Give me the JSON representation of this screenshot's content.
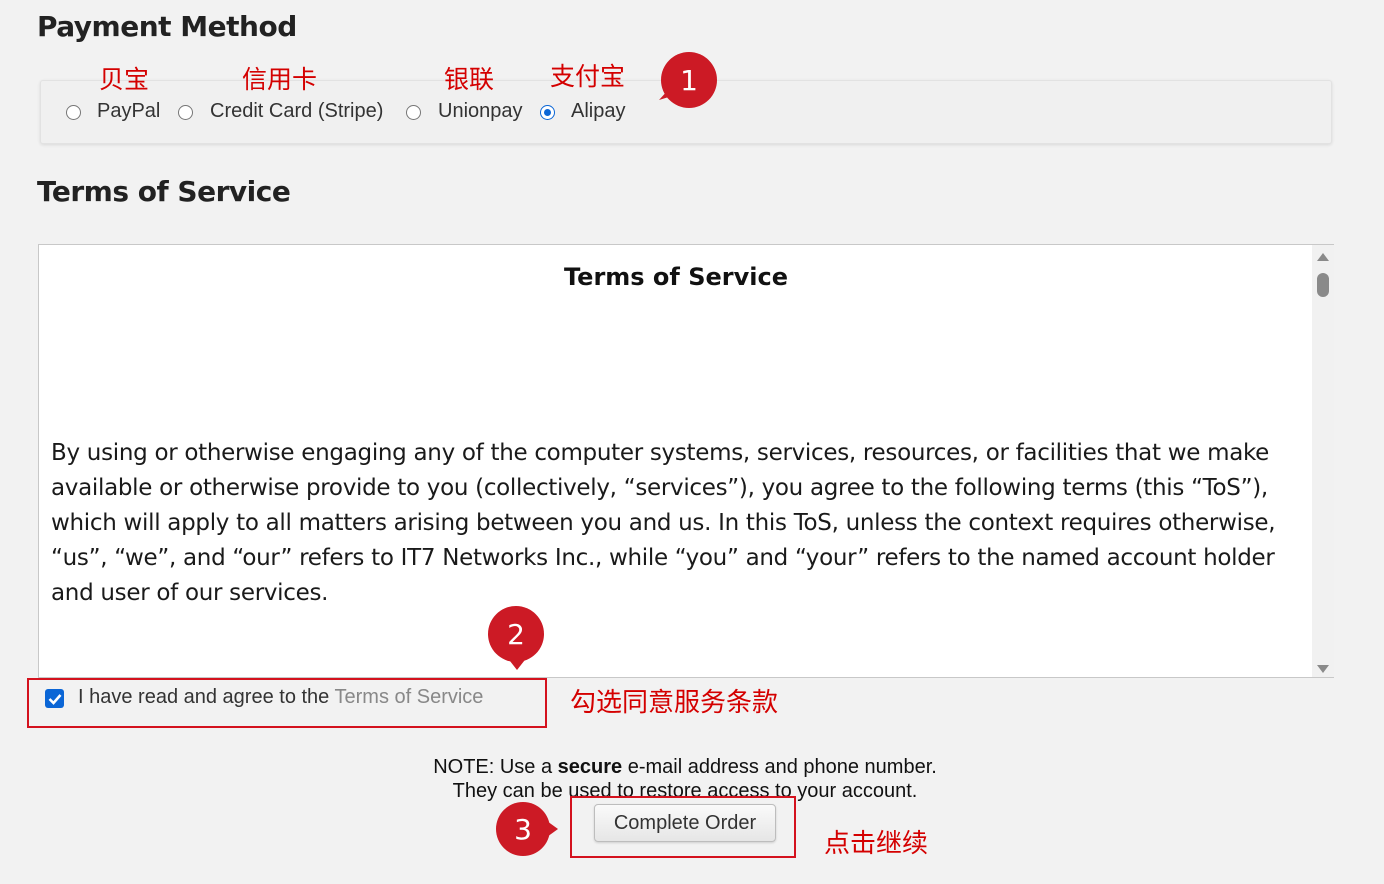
{
  "payment": {
    "title": "Payment Method",
    "options": [
      {
        "label": "PayPal",
        "cn": "贝宝",
        "selected": false
      },
      {
        "label": "Credit Card (Stripe)",
        "cn": "信用卡",
        "selected": false
      },
      {
        "label": "Unionpay",
        "cn": "银联",
        "selected": false
      },
      {
        "label": "Alipay",
        "cn": "支付宝",
        "selected": true
      }
    ]
  },
  "tos": {
    "section_title": "Terms of Service",
    "doc_title": "Terms of Service",
    "body": "By using or otherwise engaging any of the computer systems, services, resources, or facilities that we make available or otherwise provide to you (collectively, “services”), you agree to the following terms (this “ToS”), which will apply to all matters arising between you and us. In this ToS, unless the context requires otherwise, “us”, “we”, and “our” refers to IT7 Networks Inc., while “you” and “your” refers to the named account holder and user of our services."
  },
  "agree": {
    "checked": true,
    "prefix": "I have read and agree to the ",
    "link": "Terms of Service"
  },
  "note": {
    "line1_pre": "NOTE: Use a ",
    "line1_bold": "secure",
    "line1_post": " e-mail address and phone number.",
    "line2": "They can be used to restore access to your account."
  },
  "submit": {
    "label": "Complete Order"
  },
  "annotations": {
    "step1": "1",
    "step2": "2",
    "step3": "3",
    "agree_hint": "勾选同意服务条款",
    "click_hint": "点击继续"
  },
  "colors": {
    "annotation_red": "#cc1a25",
    "radio_blue": "#0b66d6"
  }
}
